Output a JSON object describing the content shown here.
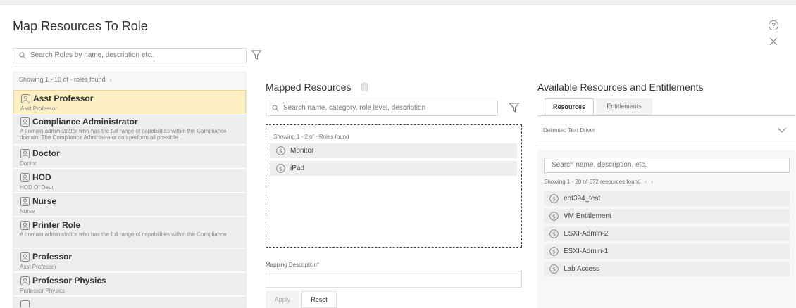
{
  "header": {
    "title": "Map Resources To Role"
  },
  "roles": {
    "search_placeholder": "Search Roles by name, description etc.,",
    "count_text": "Showing 1 - 10 of - roles found",
    "next_chevron": "›",
    "items": [
      {
        "name": "Asst Professor",
        "desc": "Asst Professor"
      },
      {
        "name": "Compliance Administrator",
        "desc": "A domain administrator who has the full range of capabilities within the Compliance domain. The Compliance Administrator can perform all possible..."
      },
      {
        "name": "Doctor",
        "desc": "Doctor"
      },
      {
        "name": "HOD",
        "desc": "HOD Of Dept"
      },
      {
        "name": "Nurse",
        "desc": "Nurse"
      },
      {
        "name": "Printer Role",
        "desc": "A domain administrator who has the full range of capabilities within the Compliance"
      },
      {
        "name": "Professor",
        "desc": "Asst Professor"
      },
      {
        "name": "Professor Physics",
        "desc": "Professor Physics"
      }
    ]
  },
  "mapped": {
    "title": "Mapped Resources",
    "search_placeholder": "Search name, category, role level, description",
    "count_text": "Showing 1 - 2 of - Roles found",
    "items": [
      {
        "label": "Monitor"
      },
      {
        "label": "iPad"
      }
    ],
    "mapping_label": "Mapping Description*",
    "apply_label": "Apply",
    "reset_label": "Reset"
  },
  "available": {
    "title": "Available Resources and Entitlements",
    "tabs": [
      {
        "label": "Resources"
      },
      {
        "label": "Entitlements"
      }
    ],
    "driver_value": "Delimited Text Driver",
    "search_placeholder": "Search name, description, etc.",
    "count_text": "Showing 1 - 20 of 672 resources found",
    "prev_chevron": "‹",
    "next_chevron": "›",
    "items": [
      {
        "label": "ent394_test"
      },
      {
        "label": "VM Entitlement"
      },
      {
        "label": "ESXI-Admin-2"
      },
      {
        "label": "ESXI-Admin-1"
      },
      {
        "label": "Lab Access"
      }
    ]
  },
  "colors": {
    "selected_bg": "#fcf0c4",
    "selected_border": "#f0d68a",
    "row_bg": "#eceef0",
    "panel_bg": "#f7f7f7"
  }
}
